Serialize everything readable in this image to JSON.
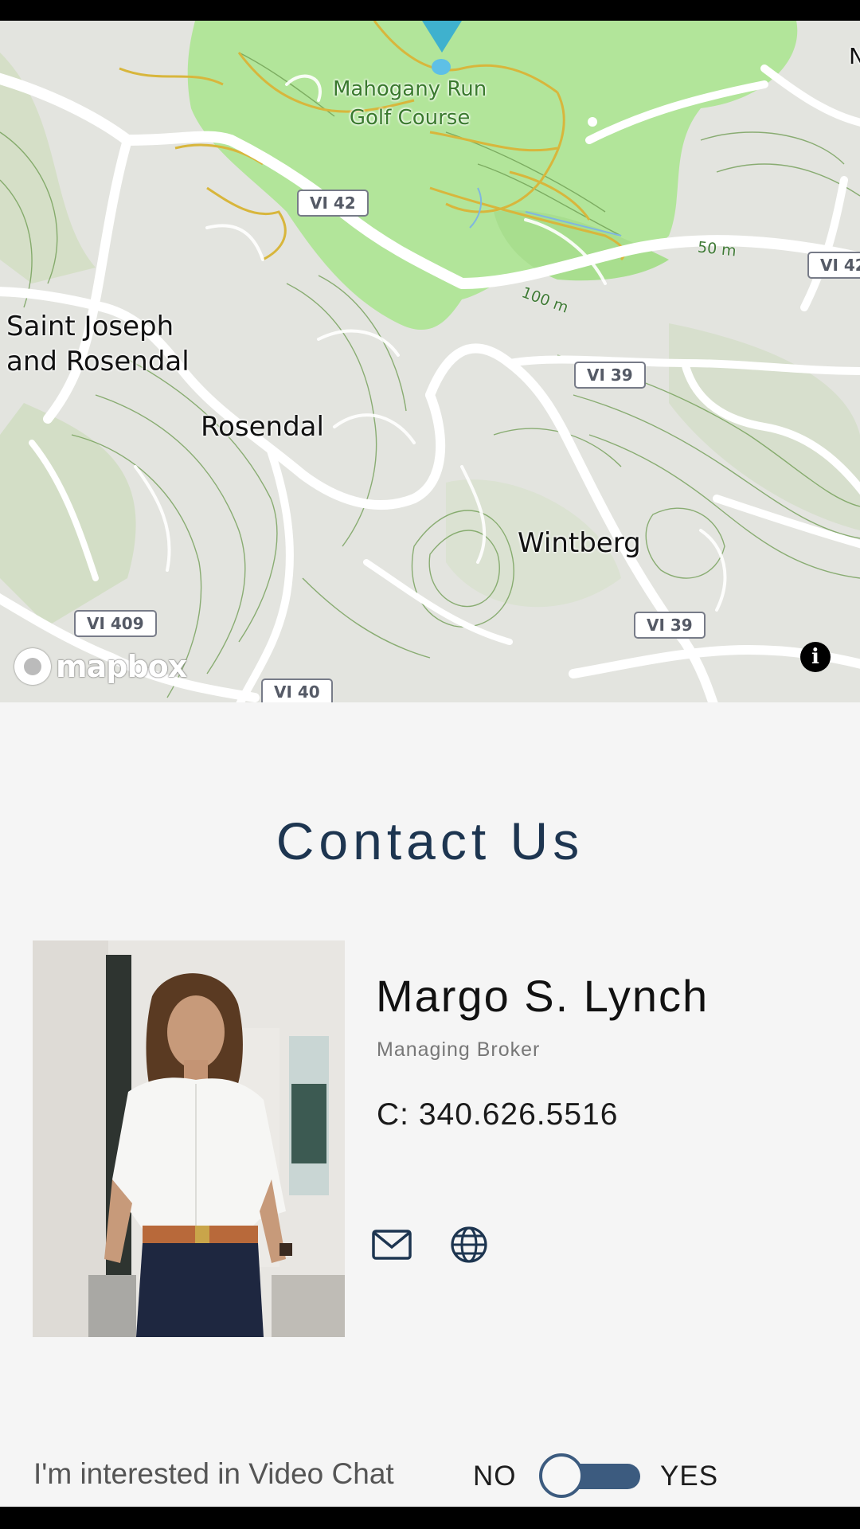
{
  "map": {
    "places": {
      "golf_line1": "Mahogany Run",
      "golf_line2": "Golf Course",
      "saint_joseph_line1": "Saint Joseph",
      "saint_joseph_line2": "and Rosendal",
      "rosendal": "Rosendal",
      "wintberg": "Wintberg",
      "edge_letter": "N"
    },
    "road_shields": {
      "vi42_a": "VI 42",
      "vi42_b": "VI 42",
      "vi39_a": "VI 39",
      "vi39_b": "VI 39",
      "vi409": "VI 409",
      "vi40": "VI 40"
    },
    "contour_labels": {
      "c50": "50 m",
      "c100": "100 m"
    },
    "attribution_logo": "mapbox",
    "info_icon": "i",
    "colors": {
      "park": "#b2e59a",
      "land": "#e3e4df",
      "road": "#ffffff",
      "contour": "#6b9a4e",
      "marker": "#3fb1ce"
    }
  },
  "contact": {
    "title": "Contact Us",
    "agent": {
      "name": "Margo S. Lynch",
      "role": "Managing Broker",
      "phone": "C: 340.626.5516"
    },
    "icons": {
      "email": "envelope-icon",
      "website": "globe-icon"
    }
  },
  "video_chat": {
    "label": "I'm interested in Video Chat",
    "no_label": "NO",
    "yes_label": "YES",
    "value": "NO",
    "accent": "#3c5b7f"
  }
}
